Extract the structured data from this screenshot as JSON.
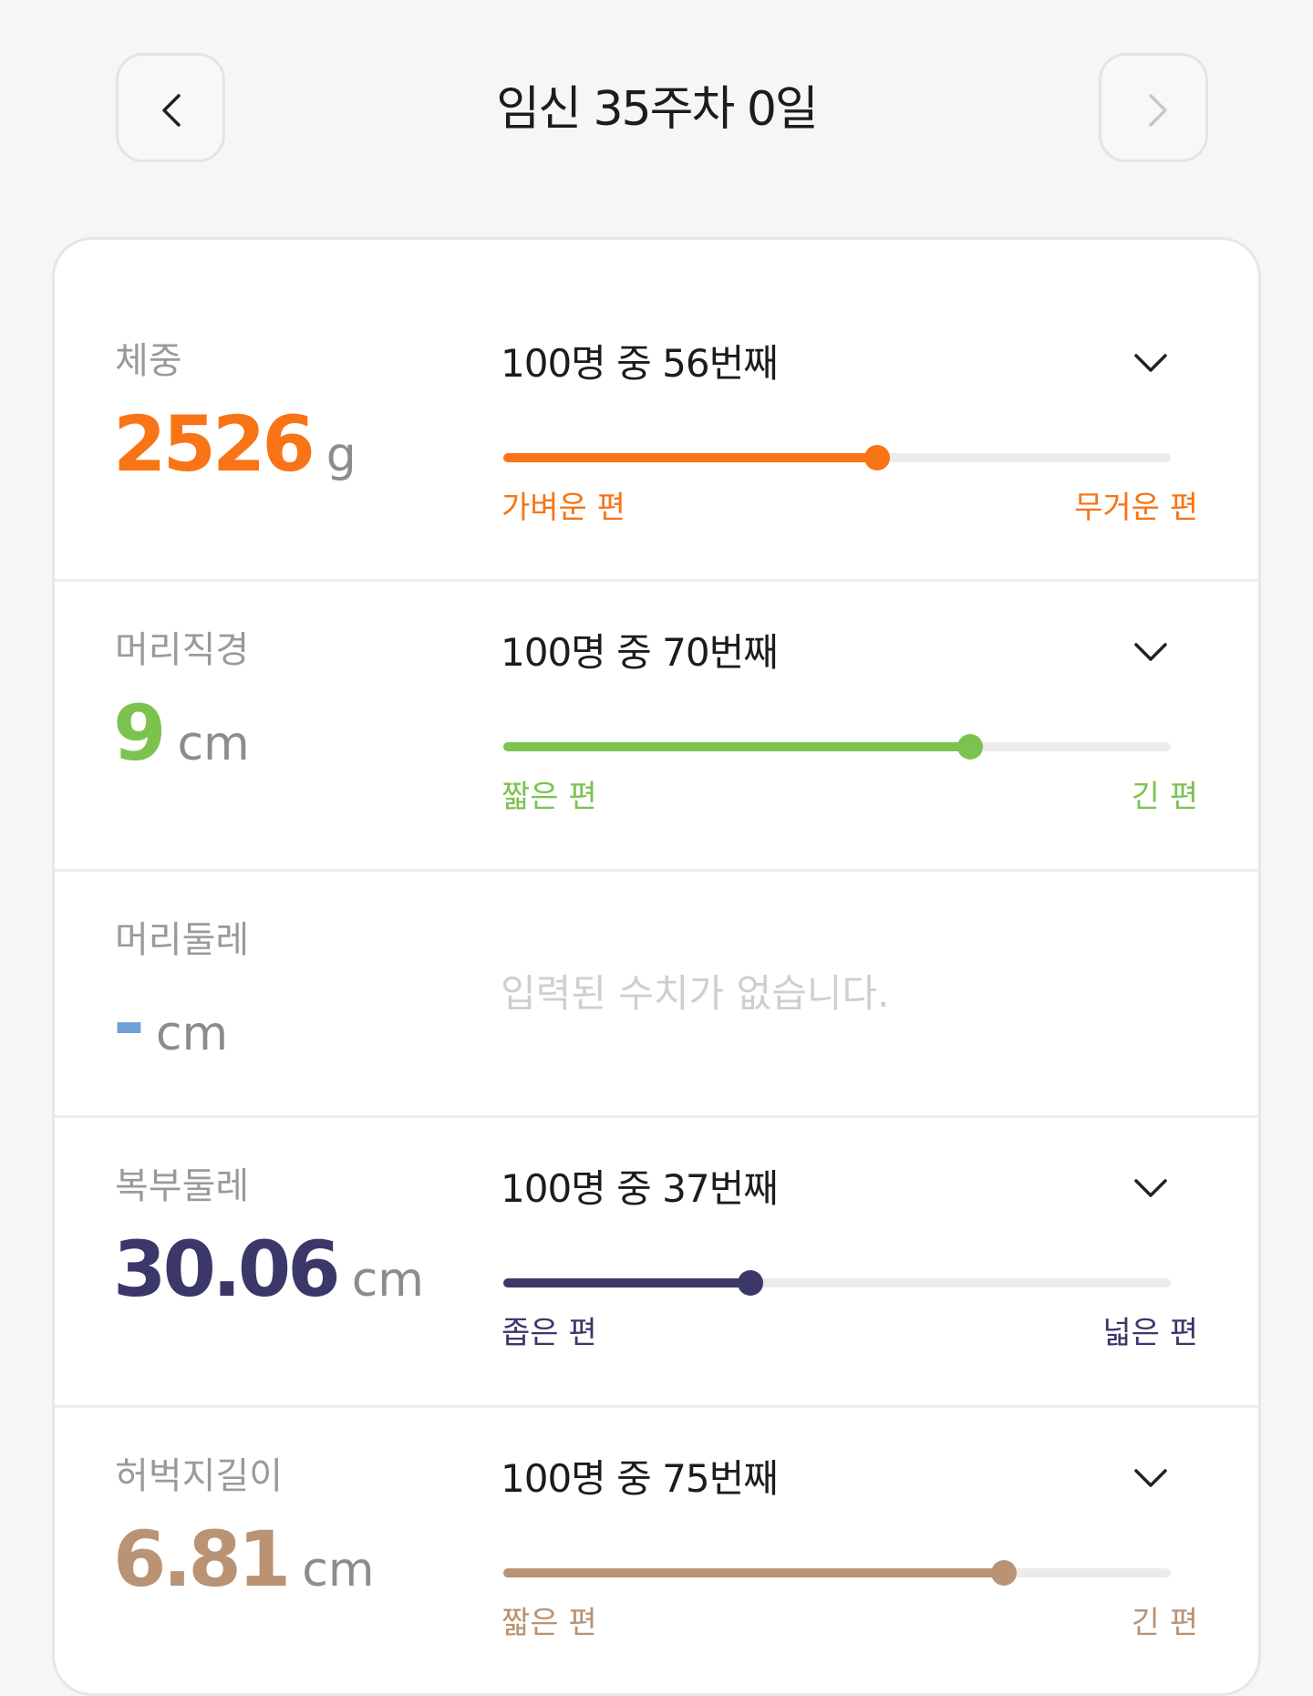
{
  "header": {
    "title": "임신 35주차 0일",
    "prev_icon": "chevron-left-icon",
    "next_icon": "chevron-right-icon"
  },
  "metrics": [
    {
      "label": "체중",
      "value": "2526",
      "unit": "g",
      "rank_text": "100명 중 56번째",
      "percentile": 0.56,
      "left_label": "가벼운 편",
      "right_label": "무거운 편",
      "color": "#f87416"
    },
    {
      "label": "머리직경",
      "value": "9",
      "unit": "cm",
      "rank_text": "100명 중 70번째",
      "percentile": 0.7,
      "left_label": "짧은 편",
      "right_label": "긴 편",
      "color": "#7cc24f"
    },
    {
      "label": "머리둘레",
      "value": "-",
      "unit": "cm",
      "empty_text": "입력된 수치가 없습니다.",
      "color": "#6d9fd8"
    },
    {
      "label": "복부둘레",
      "value": "30.06",
      "unit": "cm",
      "rank_text": "100명 중 37번째",
      "percentile": 0.37,
      "left_label": "좁은 편",
      "right_label": "넓은 편",
      "color": "#3b3769"
    },
    {
      "label": "허벅지길이",
      "value": "6.81",
      "unit": "cm",
      "rank_text": "100명 중 75번째",
      "percentile": 0.75,
      "left_label": "짧은 편",
      "right_label": "긴 편",
      "color": "#b99374"
    }
  ]
}
